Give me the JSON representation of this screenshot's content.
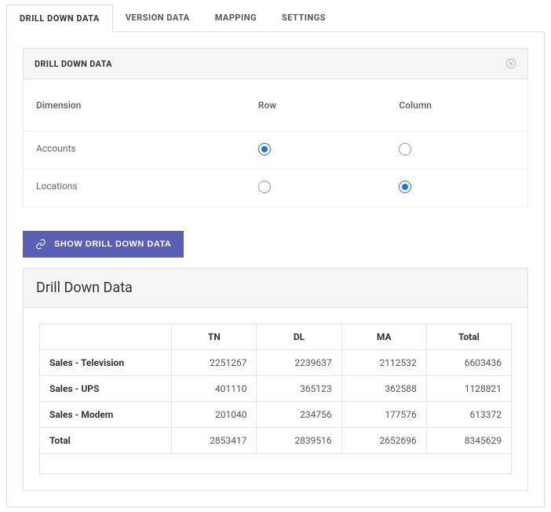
{
  "tabs": {
    "drilldown": "DRILL DOWN DATA",
    "version": "VERSION DATA",
    "mapping": "MAPPING",
    "settings": "SETTINGS"
  },
  "panel": {
    "title": "DRILL DOWN DATA"
  },
  "dim": {
    "headers": {
      "dimension": "Dimension",
      "row": "Row",
      "column": "Column"
    },
    "rows": {
      "accounts": "Accounts",
      "locations": "Locations"
    }
  },
  "button": {
    "show": "SHOW DRILL DOWN DATA"
  },
  "table": {
    "title": "Drill Down Data",
    "cols": {
      "c1": "TN",
      "c2": "DL",
      "c3": "MA",
      "c4": "Total"
    },
    "rows": [
      {
        "label": "Sales - Television",
        "v": [
          "2251267",
          "2239637",
          "2112532",
          "6603436"
        ]
      },
      {
        "label": "Sales - UPS",
        "v": [
          "401110",
          "365123",
          "362588",
          "1128821"
        ]
      },
      {
        "label": "Sales - Modem",
        "v": [
          "201040",
          "234756",
          "177576",
          "613372"
        ]
      },
      {
        "label": "Total",
        "v": [
          "2853417",
          "2839516",
          "2652696",
          "8345629"
        ]
      }
    ]
  }
}
